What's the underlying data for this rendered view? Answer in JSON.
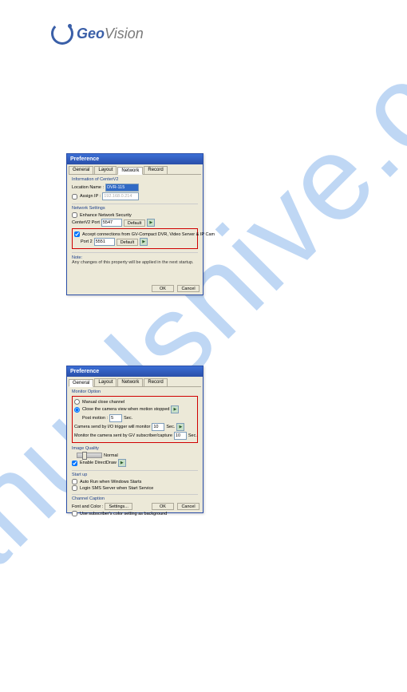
{
  "logo": {
    "brand": "Geo",
    "brand2": "Vision"
  },
  "dialog1": {
    "title": "Preference",
    "tabs": {
      "general": "General",
      "layout": "Layout",
      "network": "Network",
      "record": "Record"
    },
    "info": {
      "title": "Information of CenterV2",
      "locationLabel": "Location Name :",
      "locationValue": "DVR-115",
      "assignIpLabel": "Assign IP :",
      "assignIpValue": "192.168.0.214"
    },
    "net": {
      "title": "Network Settings",
      "enhanceLabel": "Enhance Network Security",
      "portLabel": "CenterV2 Port",
      "portValue": "5547",
      "defaultBtn": "Default"
    },
    "accept": {
      "label": "Accept connections from GV-Compact DVR, Video Server & IP Cam",
      "port2Label": "Port 2",
      "port2Value": "5551",
      "defaultBtn": "Default"
    },
    "note": {
      "title": "Note:",
      "text": "Any changes of this property will be applied in the next startup."
    },
    "ok": "OK",
    "cancel": "Cancel"
  },
  "dialog2": {
    "title": "Preference",
    "tabs": {
      "general": "General",
      "layout": "Layout",
      "network": "Network",
      "record": "Record"
    },
    "monitor": {
      "title": "Monitor Option",
      "manualLabel": "Manual close channel",
      "closeLabel": "Close the camera view when motion stopped",
      "postLabel": "Post motion :",
      "postValue": "5",
      "postUnit": "Sec.",
      "ioLabel": "Camera send by I/O trigger will monitor",
      "ioValue": "10",
      "ioUnit": "Sec.",
      "regLabel": "Monitor the camera sent by GV subscriber/capture",
      "regValue": "10",
      "regUnit": "Sec."
    },
    "quality": {
      "title": "Image Quality",
      "normalLabel": "Normal",
      "enableLabel": "Enable DirectDraw"
    },
    "startup": {
      "title": "Start up",
      "autoLabel": "Auto Run when Windows Starts",
      "loginLabel": "Login SMS Server when Start Service"
    },
    "caption": {
      "title": "Channel Caption",
      "fontLabel": "Font and Color :",
      "settingsBtn": "Settings...",
      "useSubLabel": "Use subscriber's color setting as background"
    },
    "ok": "OK",
    "cancel": "Cancel"
  }
}
